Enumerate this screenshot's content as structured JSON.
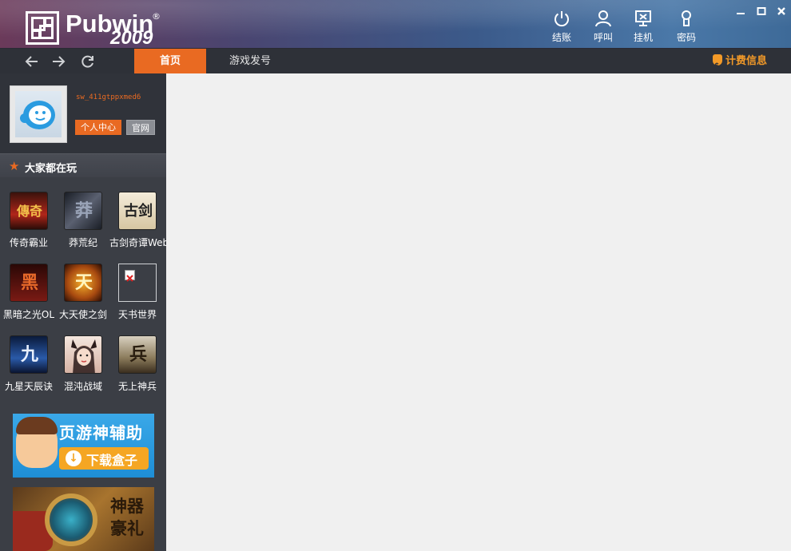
{
  "app": {
    "logo_text": "Pubwin",
    "logo_year": "2009",
    "logo_reg": "®"
  },
  "topbar": {
    "buttons": [
      {
        "label": "结账",
        "icon": "power-icon"
      },
      {
        "label": "呼叫",
        "icon": "user-call-icon"
      },
      {
        "label": "挂机",
        "icon": "monitor-lock-icon"
      },
      {
        "label": "密码",
        "icon": "key-icon"
      }
    ],
    "window_controls": [
      "minimize-icon",
      "maximize-icon",
      "close-icon"
    ]
  },
  "navbar": {
    "back_icon": "arrow-left-icon",
    "forward_icon": "arrow-right-icon",
    "refresh_icon": "refresh-icon",
    "tabs": [
      {
        "label": "首页",
        "active": true
      },
      {
        "label": "游戏发号",
        "active": false
      }
    ],
    "billing_label": "计费信息"
  },
  "user": {
    "username": "sw_411gtppxmed6",
    "center_button": "个人中心",
    "site_button": "官网"
  },
  "popular": {
    "title": "大家都在玩",
    "games": [
      {
        "name": "传奇霸业",
        "glyph": "傳奇",
        "color": "#b0261a"
      },
      {
        "name": "莽荒纪",
        "glyph": "莽",
        "color": "#2a2f38"
      },
      {
        "name": "古剑奇谭Web",
        "glyph": "古剑",
        "color": "#e8dcc4"
      },
      {
        "name": "黑暗之光OL",
        "glyph": "黑",
        "color": "#7a1a14"
      },
      {
        "name": "大天使之剑",
        "glyph": "天",
        "color": "#c86a14"
      },
      {
        "name": "天书世界",
        "glyph": "",
        "color": "#3b3e45"
      },
      {
        "name": "九星天辰诀",
        "glyph": "九",
        "color": "#1c3a78"
      },
      {
        "name": "混沌战域",
        "glyph": "",
        "color": "#d8c2b4"
      },
      {
        "name": "无上神兵",
        "glyph": "兵",
        "color": "#8a7a5a"
      }
    ]
  },
  "ads": {
    "ad1_title": "页游神辅助",
    "ad1_button": "下载盒子",
    "ad2_title": "神器豪礼"
  },
  "colors": {
    "accent": "#e96a22",
    "sidebar": "#3b3e45",
    "navbar": "#2e3138",
    "billing": "#f39a28"
  }
}
